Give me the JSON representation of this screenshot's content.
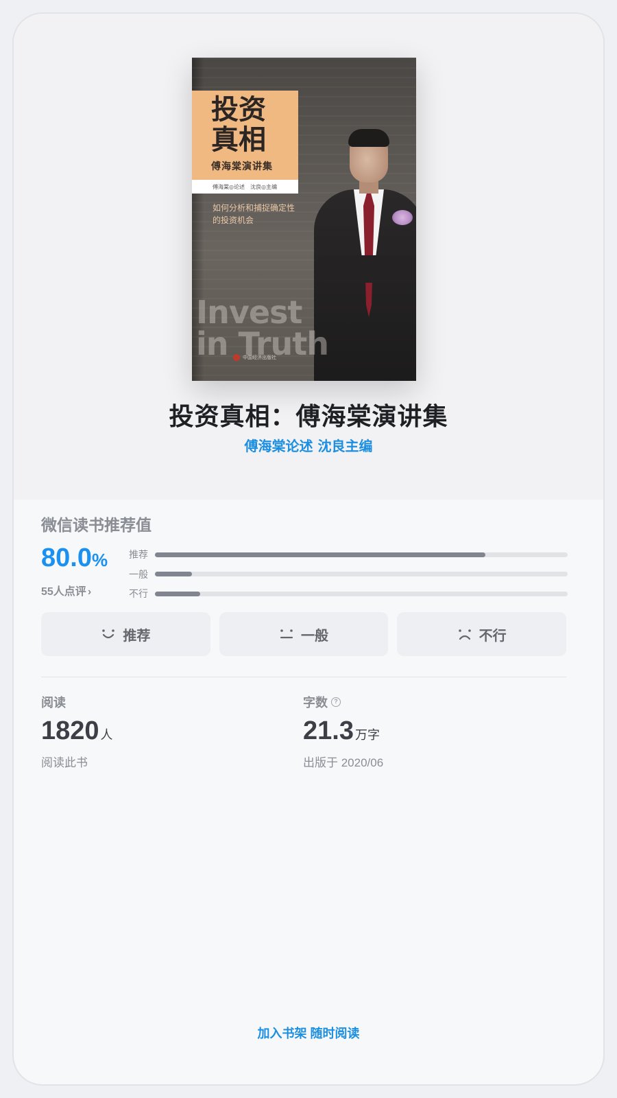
{
  "book": {
    "title": "投资真相：傅海棠演讲集",
    "author": "傅海棠论述 沈良主编",
    "cover": {
      "title": "投资真相",
      "subtitle": "傅海棠演讲集",
      "author_strip": "傅海棠◎论述　沈良◎主编",
      "description": "如何分析和捕捉确定性的投资机会",
      "english": "Invest in Truth",
      "publisher": "中国经济出版社"
    }
  },
  "rating": {
    "label": "微信读书推荐值",
    "score_number": "80.0",
    "score_unit": "%",
    "count_text": "55人点评",
    "chevron": "›",
    "bars": [
      {
        "label": "推荐",
        "fraction": 0.8
      },
      {
        "label": "一般",
        "fraction": 0.09
      },
      {
        "label": "不行",
        "fraction": 0.11
      }
    ]
  },
  "votes": [
    {
      "label": "推荐",
      "icon": "smile-icon"
    },
    {
      "label": "一般",
      "icon": "neutral-face-icon"
    },
    {
      "label": "不行",
      "icon": "frown-icon"
    }
  ],
  "stats": {
    "reading": {
      "header": "阅读",
      "value": "1820",
      "unit": "人",
      "sub": "阅读此书"
    },
    "words": {
      "header": "字数",
      "help": "?",
      "value": "21.3",
      "unit": "万字",
      "sub": "出版于 2020/06"
    }
  },
  "footer": {
    "link_text": "加入书架 随时阅读"
  },
  "colors": {
    "accent": "#1a90f0",
    "link": "#1d8fe0",
    "muted": "#8a8d94",
    "bar_fill": "#80858f"
  }
}
